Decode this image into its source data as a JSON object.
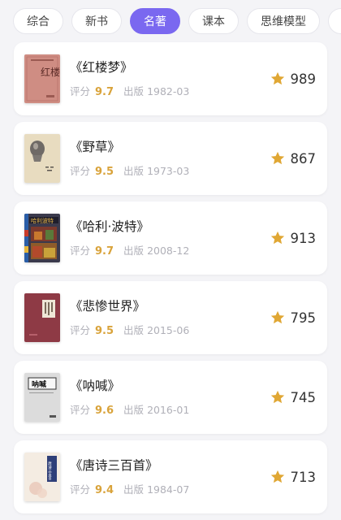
{
  "tabs": [
    {
      "label": "综合",
      "active": false
    },
    {
      "label": "新书",
      "active": false
    },
    {
      "label": "名著",
      "active": true
    },
    {
      "label": "课本",
      "active": false
    },
    {
      "label": "思维模型",
      "active": false
    },
    {
      "label": "经",
      "active": false
    }
  ],
  "labels": {
    "score": "评分",
    "publish": "出版"
  },
  "colors": {
    "accent": "#7a68f0",
    "score": "#d9a33b",
    "star": "#e0a734"
  },
  "books": [
    {
      "title": "《红楼梦》",
      "score": "9.7",
      "date": "1982-03",
      "count": "989",
      "cover_text": "红楼梦"
    },
    {
      "title": "《野草》",
      "score": "9.5",
      "date": "1973-03",
      "count": "867",
      "cover_text": ""
    },
    {
      "title": "《哈利·波特》",
      "score": "9.7",
      "date": "2008-12",
      "count": "913",
      "cover_text": "哈利波特"
    },
    {
      "title": "《悲惨世界》",
      "score": "9.5",
      "date": "2015-06",
      "count": "795",
      "cover_text": ""
    },
    {
      "title": "《呐喊》",
      "score": "9.6",
      "date": "2016-01",
      "count": "745",
      "cover_text": "呐喊"
    },
    {
      "title": "《唐诗三百首》",
      "score": "9.4",
      "date": "1984-07",
      "count": "713",
      "cover_text": "唐诗三百首"
    }
  ]
}
